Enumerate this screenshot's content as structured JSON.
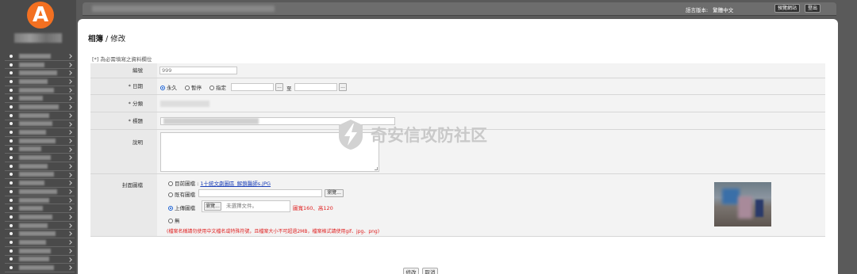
{
  "sidebar": {
    "logo_letter": "A",
    "menu_count": 26
  },
  "header": {
    "lang_label": "語言版本:",
    "lang_value": "繁體中文",
    "preview_button": "預覽網站",
    "logout_button": "登出"
  },
  "page": {
    "title_section": "相簿",
    "title_sep": " / ",
    "title_action": "修改",
    "required_note": "[*] 為必需填寫之資料欄位"
  },
  "form": {
    "id": {
      "label": "編號",
      "value": "999"
    },
    "date": {
      "label": "* 日期",
      "options": [
        "永久",
        "暫停",
        "指定"
      ],
      "selected": "永久",
      "picker_button": "...",
      "to_label": "至"
    },
    "category": {
      "label": "* 分類"
    },
    "heading": {
      "label": "* 標題"
    },
    "description": {
      "label": "說明"
    },
    "cover": {
      "label": "封面圖檔",
      "current_option": "目前圖檔 :",
      "current_file": "1十統文劇圖區_解鎖醫師s.JPG",
      "existing_option": "既有圖檔",
      "browse_server_button": "瀏覽...",
      "upload_option": "上傳圖檔",
      "browse_button": "瀏覽...",
      "no_file_text": "未選擇文件。",
      "size_hint": "圖寬160、高120",
      "none_option": "無",
      "warning": "(檔案名稱請勿使用中文檔名或特殊符號，且檔案大小不可超過2MB，檔案格式請使用gif、jpg、png)"
    }
  },
  "actions": {
    "submit": "修改",
    "cancel": "取消"
  },
  "watermark": {
    "text": "奇安信攻防社区"
  },
  "colors": {
    "logo": "#f37021",
    "link": "#1a3fb8",
    "warning": "#e02020",
    "sidebar": "#4a4a4a"
  }
}
